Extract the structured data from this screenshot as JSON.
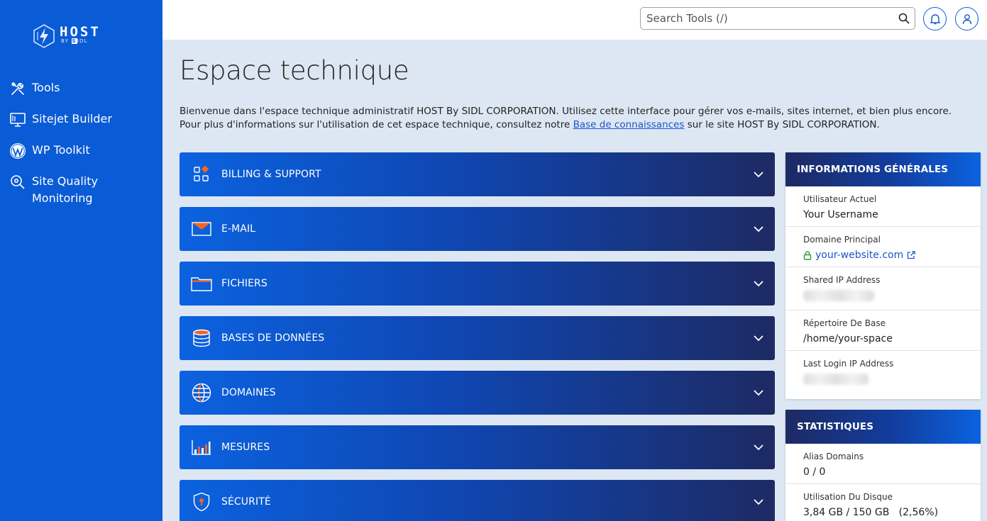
{
  "brand": {
    "name": "HOST",
    "tagline_prefix": "BY",
    "tagline_badge": "S",
    "tagline_suffix": "IDL"
  },
  "sidebar": {
    "items": [
      {
        "label": "Tools",
        "icon": "tools-icon"
      },
      {
        "label": "Sitejet Builder",
        "icon": "monitor-icon"
      },
      {
        "label": "WP Toolkit",
        "icon": "wordpress-icon"
      },
      {
        "label": "Site Quality Monitoring",
        "icon": "search-settings-icon"
      }
    ]
  },
  "topbar": {
    "search_placeholder": "Search Tools (/)"
  },
  "main": {
    "title": "Espace technique",
    "intro_before": "Bienvenue dans l'espace technique administratif HOST By SIDL CORPORATION. Utilisez cette interface pour gérer vos e-mails, sites internet, et bien plus encore. Pour plus d'informations sur l'utilisation de cet espace technique, consultez notre ",
    "intro_link": "Base de connaissances",
    "intro_after": " sur le site HOST By SIDL CORPORATION.",
    "sections": [
      {
        "label": "BILLING & SUPPORT",
        "icon": "apps-icon"
      },
      {
        "label": "E-MAIL",
        "icon": "envelope-icon"
      },
      {
        "label": "FICHIERS",
        "icon": "folder-icon"
      },
      {
        "label": "BASES DE DONNÉES",
        "icon": "database-icon"
      },
      {
        "label": "DOMAINES",
        "icon": "globe-icon"
      },
      {
        "label": "MESURES",
        "icon": "bar-chart-icon"
      },
      {
        "label": "SÉCURITÉ",
        "icon": "shield-icon"
      }
    ]
  },
  "info_panel": {
    "title": "INFORMATIONS GÉNÉRALES",
    "rows": [
      {
        "label": "Utilisateur Actuel",
        "value": "Your Username"
      },
      {
        "label": "Domaine Principal",
        "value": "your-website.com"
      },
      {
        "label": "Shared IP Address",
        "value": ""
      },
      {
        "label": "Répertoire De Base",
        "value": "/home/your-space"
      },
      {
        "label": "Last Login IP Address",
        "value": ""
      }
    ]
  },
  "stats_panel": {
    "title": "STATISTIQUES",
    "rows": [
      {
        "label": "Alias Domains",
        "value": "0 / 0"
      },
      {
        "label": "Utilisation Du Disque",
        "value": "3,84 GB / 150 GB   (2,56%)"
      }
    ]
  },
  "colors": {
    "sidebar": "#0a5bd6",
    "accent_orange": "#f26522",
    "link": "#1b56c8",
    "lock_green": "#2e9d3b"
  }
}
